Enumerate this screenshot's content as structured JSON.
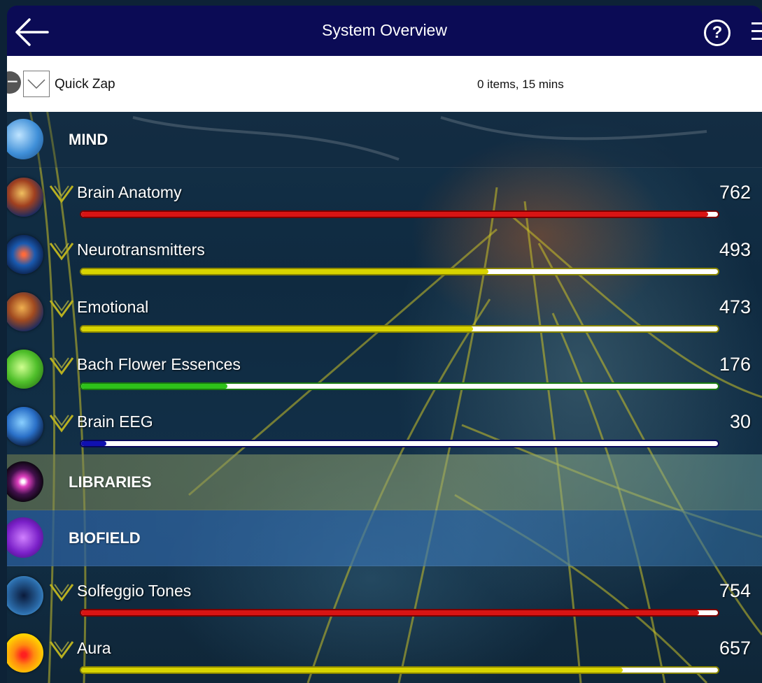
{
  "header": {
    "title": "System Overview"
  },
  "quick_zap": {
    "label": "Quick Zap",
    "info": "0 items, 15 mins"
  },
  "colors": {
    "header_bg": "#0b0b55",
    "red": "#d81414",
    "yellow": "#d8d400",
    "green": "#2ec21a",
    "blue": "#1010b0"
  },
  "sections": [
    {
      "label": "MIND",
      "icon": "mind-brain-icon",
      "items": [
        {
          "label": "Brain Anatomy",
          "value": "762",
          "icon": "brain-anatomy-icon",
          "color": "#d81414",
          "border": "#7a0000",
          "fill": 0.985
        },
        {
          "label": "Neurotransmitters",
          "value": "493",
          "icon": "neurotransmitters-icon",
          "color": "#d8d400",
          "border": "#8a8600",
          "fill": 0.64
        },
        {
          "label": "Emotional",
          "value": "473",
          "icon": "emotional-head-icon",
          "color": "#d8d400",
          "border": "#8a8600",
          "fill": 0.615
        },
        {
          "label": "Bach Flower Essences",
          "value": "176",
          "icon": "bach-flower-icon",
          "color": "#2ec21a",
          "border": "#1a7a10",
          "fill": 0.23
        },
        {
          "label": "Brain EEG",
          "value": "30",
          "icon": "brain-eeg-icon",
          "color": "#1010b0",
          "border": "#08085a",
          "fill": 0.04
        }
      ]
    },
    {
      "label": "LIBRARIES",
      "icon": "libraries-light-icon",
      "items": []
    },
    {
      "label": "BIOFIELD",
      "icon": "biofield-flower-of-life-icon",
      "items": [
        {
          "label": "Solfeggio Tones",
          "value": "754",
          "icon": "solfeggio-geometry-icon",
          "color": "#d81414",
          "border": "#7a0000",
          "fill": 0.97
        },
        {
          "label": "Aura",
          "value": "657",
          "icon": "aura-icon",
          "color": "#d8d400",
          "border": "#8a8600",
          "fill": 0.85
        }
      ]
    }
  ]
}
